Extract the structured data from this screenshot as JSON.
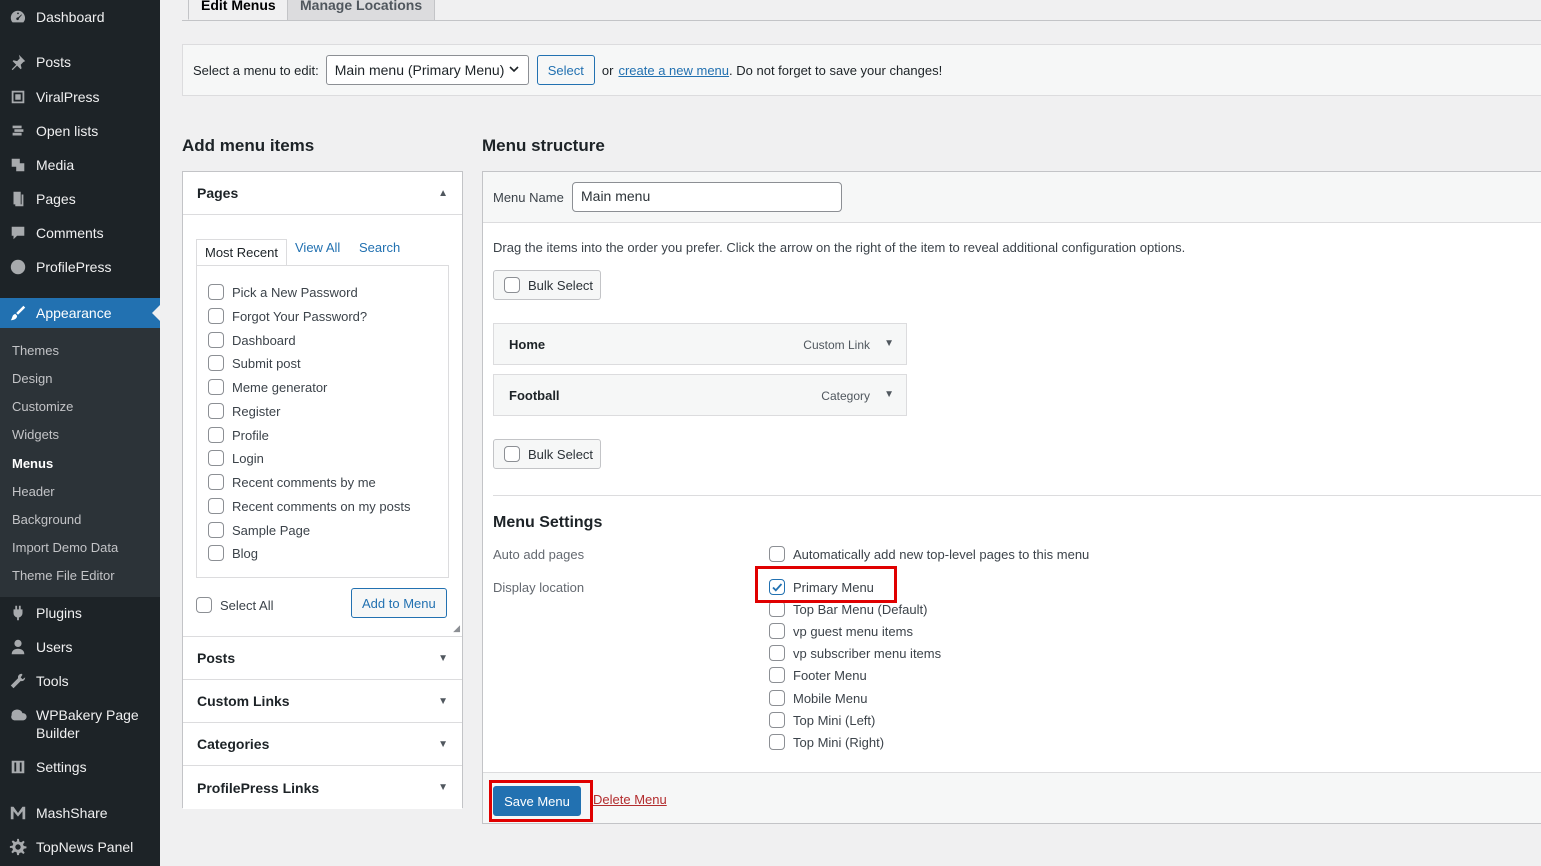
{
  "sidebar": {
    "items": [
      {
        "label": "Dashboard",
        "icon": "dashboard-icon"
      },
      {
        "label": "Posts",
        "icon": "pin-icon"
      },
      {
        "label": "ViralPress",
        "icon": "viralpress-icon"
      },
      {
        "label": "Open lists",
        "icon": "list-icon"
      },
      {
        "label": "Media",
        "icon": "media-icon"
      },
      {
        "label": "Pages",
        "icon": "pages-icon"
      },
      {
        "label": "Comments",
        "icon": "comments-icon"
      },
      {
        "label": "ProfilePress",
        "icon": "profilepress-icon"
      },
      {
        "label": "Appearance",
        "icon": "brush-icon"
      },
      {
        "label": "Plugins",
        "icon": "plugin-icon"
      },
      {
        "label": "Users",
        "icon": "users-icon"
      },
      {
        "label": "Tools",
        "icon": "wrench-icon"
      },
      {
        "label": "WPBakery Page Builder",
        "icon": "wpbakery-icon"
      },
      {
        "label": "Settings",
        "icon": "settings-icon"
      },
      {
        "label": "MashShare",
        "icon": "mashshare-icon"
      },
      {
        "label": "TopNews Panel",
        "icon": "gear-icon"
      }
    ],
    "submenu": [
      "Themes",
      "Design",
      "Customize",
      "Widgets",
      "Menus",
      "Header",
      "Background",
      "Import Demo Data",
      "Theme File Editor"
    ]
  },
  "tabs": {
    "edit": "Edit Menus",
    "manage": "Manage Locations"
  },
  "manage_bar": {
    "label": "Select a menu to edit:",
    "selected_menu": "Main menu (Primary Menu)",
    "select_button": "Select",
    "or_text": "or",
    "create_link": "create a new menu",
    "reminder": ". Do not forget to save your changes!"
  },
  "add_items": {
    "title": "Add menu items",
    "pages_section": "Pages",
    "tabs": [
      "Most Recent",
      "View All",
      "Search"
    ],
    "pages": [
      "Pick a New Password",
      "Forgot Your Password?",
      "Dashboard",
      "Submit post",
      "Meme generator",
      "Register",
      "Profile",
      "Login",
      "Recent comments by me",
      "Recent comments on my posts",
      "Sample Page",
      "Blog"
    ],
    "select_all": "Select All",
    "add_button": "Add to Menu",
    "sections": [
      "Posts",
      "Custom Links",
      "Categories",
      "ProfilePress Links"
    ]
  },
  "structure": {
    "title": "Menu structure",
    "menu_name_label": "Menu Name",
    "menu_name_value": "Main menu",
    "instructions": "Drag the items into the order you prefer. Click the arrow on the right of the item to reveal additional configuration options.",
    "bulk_select": "Bulk Select",
    "items": [
      {
        "title": "Home",
        "type": "Custom Link"
      },
      {
        "title": "Football",
        "type": "Category"
      }
    ],
    "settings_title": "Menu Settings",
    "auto_add_label": "Auto add pages",
    "auto_add_text": "Automatically add new top-level pages to this menu",
    "display_location_label": "Display location",
    "locations": [
      {
        "label": "Primary Menu",
        "checked": true
      },
      {
        "label": "Top Bar Menu (Default)",
        "checked": false
      },
      {
        "label": "vp guest menu items",
        "checked": false
      },
      {
        "label": "vp subscriber menu items",
        "checked": false
      },
      {
        "label": "Footer Menu",
        "checked": false
      },
      {
        "label": "Mobile Menu",
        "checked": false
      },
      {
        "label": "Top Mini (Left)",
        "checked": false
      },
      {
        "label": "Top Mini (Right)",
        "checked": false
      }
    ],
    "save_button": "Save Menu",
    "delete_link": "Delete Menu"
  },
  "colors": {
    "accent": "#2271b1",
    "sidebar": "#1d2327",
    "highlight": "#e00000"
  }
}
